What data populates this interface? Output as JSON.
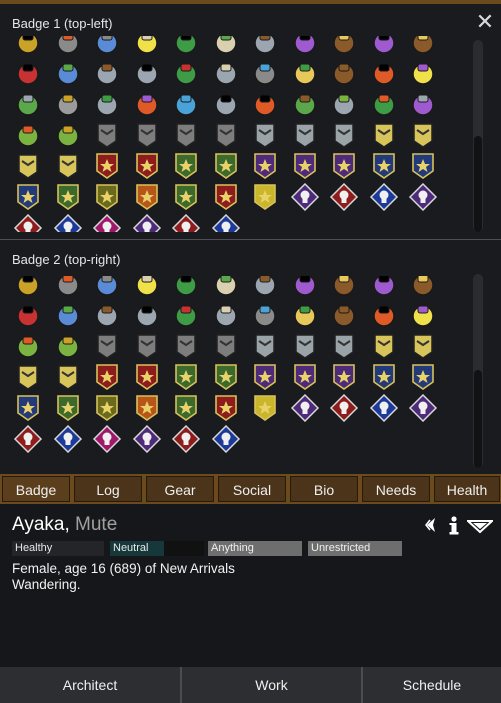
{
  "window": {
    "close_glyph": "✕"
  },
  "sections": [
    {
      "title": "Badge 1 (top-left)"
    },
    {
      "title": "Badge 2 (top-right)"
    }
  ],
  "tabs": [
    "Badge",
    "Log",
    "Gear",
    "Social",
    "Bio",
    "Needs",
    "Health"
  ],
  "pawn": {
    "name": "Ayaka",
    "sep": ", ",
    "title": "Mute",
    "bars": [
      "Healthy",
      "Neutral",
      "Anything",
      "Unrestricted"
    ],
    "line1": "Female, age 16 (689) of New Arrivals",
    "line2": "Wandering."
  },
  "bottom_buttons": [
    "Architect",
    "Work",
    "Schedule"
  ],
  "colors": {
    "tab_bg": "#4b3419",
    "panel_bg": "#191b1f",
    "frame": "#6b4a1e"
  }
}
